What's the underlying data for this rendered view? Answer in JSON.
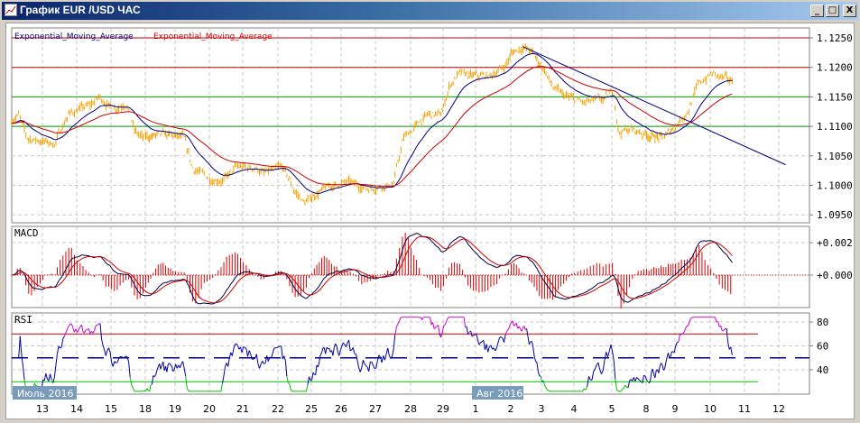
{
  "window": {
    "title": "График EUR /USD  ЧАС",
    "minimize": "_",
    "maximize": "□",
    "close": "X"
  },
  "legend": {
    "ema1": "Exponential_Moving_Average",
    "ema2": "Exponential_Moving_Average",
    "ema1_color": "#000080",
    "ema2_color": "#cc0000"
  },
  "chart_data": {
    "type": "line",
    "symbol": "EUR/USD",
    "timeframe": "H1",
    "x_labels": [
      "13",
      "14",
      "15",
      "18",
      "19",
      "20",
      "21",
      "22",
      "25",
      "26",
      "27",
      "28",
      "29",
      "1",
      "2",
      "3",
      "4",
      "5",
      "8",
      "9",
      "10",
      "11",
      "12"
    ],
    "months": [
      {
        "label": "Июль 2016",
        "at": "13"
      },
      {
        "label": "Авг 2016",
        "at": "1"
      }
    ],
    "price": {
      "y_ticks": [
        "1.1250",
        "1.1200",
        "1.1150",
        "1.1100",
        "1.1050",
        "1.1000",
        "1.0950"
      ],
      "ylim": [
        1.094,
        1.126
      ],
      "path_day_index": [
        -0.9,
        -0.7,
        -0.45,
        0,
        0.35,
        0.75,
        1.1,
        1.4,
        1.65,
        2.05,
        2.45,
        2.7,
        2.95,
        3.35,
        3.75,
        4.25,
        4.5,
        5.05,
        5.45,
        5.8,
        6.35,
        6.6,
        7.15,
        7.5,
        7.8,
        8.15,
        8.7,
        9.2,
        9.75,
        10.25,
        10.5,
        10.8,
        11.15,
        11.55,
        11.95,
        12.2,
        12.5,
        12.85,
        13.4,
        13.8,
        14.05,
        14.4,
        14.7,
        15.1,
        15.35,
        15.75,
        16.25,
        16.8,
        17.05,
        17.2,
        17.55,
        18.1,
        18.6,
        19.0,
        19.4,
        19.65,
        20.05,
        20.45,
        20.65
      ],
      "path_close": [
        1.111,
        1.112,
        1.108,
        1.1075,
        1.107,
        1.112,
        1.113,
        1.1135,
        1.115,
        1.113,
        1.114,
        1.109,
        1.108,
        1.1085,
        1.1085,
        1.108,
        1.103,
        1.101,
        1.101,
        1.103,
        1.103,
        1.102,
        1.103,
        1.099,
        1.097,
        1.0985,
        1.1,
        1.1005,
        1.0995,
        1.1,
        1.1,
        1.108,
        1.11,
        1.112,
        1.112,
        1.117,
        1.119,
        1.1185,
        1.1185,
        1.12,
        1.1225,
        1.1235,
        1.1225,
        1.1195,
        1.1165,
        1.115,
        1.114,
        1.1145,
        1.116,
        1.109,
        1.1095,
        1.1085,
        1.108,
        1.11,
        1.113,
        1.117,
        1.119,
        1.118,
        1.1175
      ],
      "horizontal_levels": [
        {
          "value": 1.125,
          "color": "#cc0000"
        },
        {
          "value": 1.12,
          "color": "#cc0000"
        },
        {
          "value": 1.115,
          "color": "#00a000"
        },
        {
          "value": 1.11,
          "color": "#00a000"
        }
      ],
      "trendline": {
        "from": [
          14.4,
          1.1235
        ],
        "to": [
          22.2,
          1.1035
        ],
        "color": "#000080"
      },
      "bar_color": "#f0a000"
    },
    "macd": {
      "label": "MACD",
      "y_ticks": [
        "+0.002",
        "+0.000"
      ],
      "line_color": "#000040",
      "signal_color": "#cc0000",
      "hist_color": "#dd0000"
    },
    "rsi": {
      "label": "RSI",
      "y_ticks": [
        "80",
        "60",
        "40"
      ],
      "levels": [
        70,
        50,
        30
      ],
      "line_color": "#0000a0",
      "overbought_color": "#cc00cc",
      "oversold_color": "#00c000"
    }
  }
}
